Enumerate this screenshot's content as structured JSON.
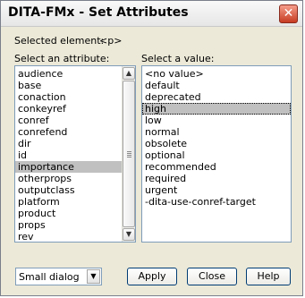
{
  "window": {
    "title": "DITA-FMx - Set Attributes",
    "close_glyph": "✕"
  },
  "selected_element": {
    "label": "Selected element:",
    "value": "<p>"
  },
  "attributes": {
    "label": "Select an attribute:",
    "items": [
      "audience",
      "base",
      "conaction",
      "conkeyref",
      "conref",
      "conrefend",
      "dir",
      "id",
      "importance",
      "otherprops",
      "outputclass",
      "platform",
      "product",
      "props",
      "rev"
    ],
    "selected": "importance"
  },
  "values": {
    "label": "Select a value:",
    "items": [
      "<no value>",
      "default",
      "deprecated",
      "high",
      "low",
      "normal",
      "obsolete",
      "optional",
      "recommended",
      "required",
      "urgent",
      "-dita-use-conref-target"
    ],
    "selected": "high"
  },
  "dialog_size": {
    "value": "Small dialog"
  },
  "buttons": {
    "apply": "Apply",
    "close": "Close",
    "help": "Help"
  },
  "icons": {
    "up": "▲",
    "down": "▼"
  }
}
